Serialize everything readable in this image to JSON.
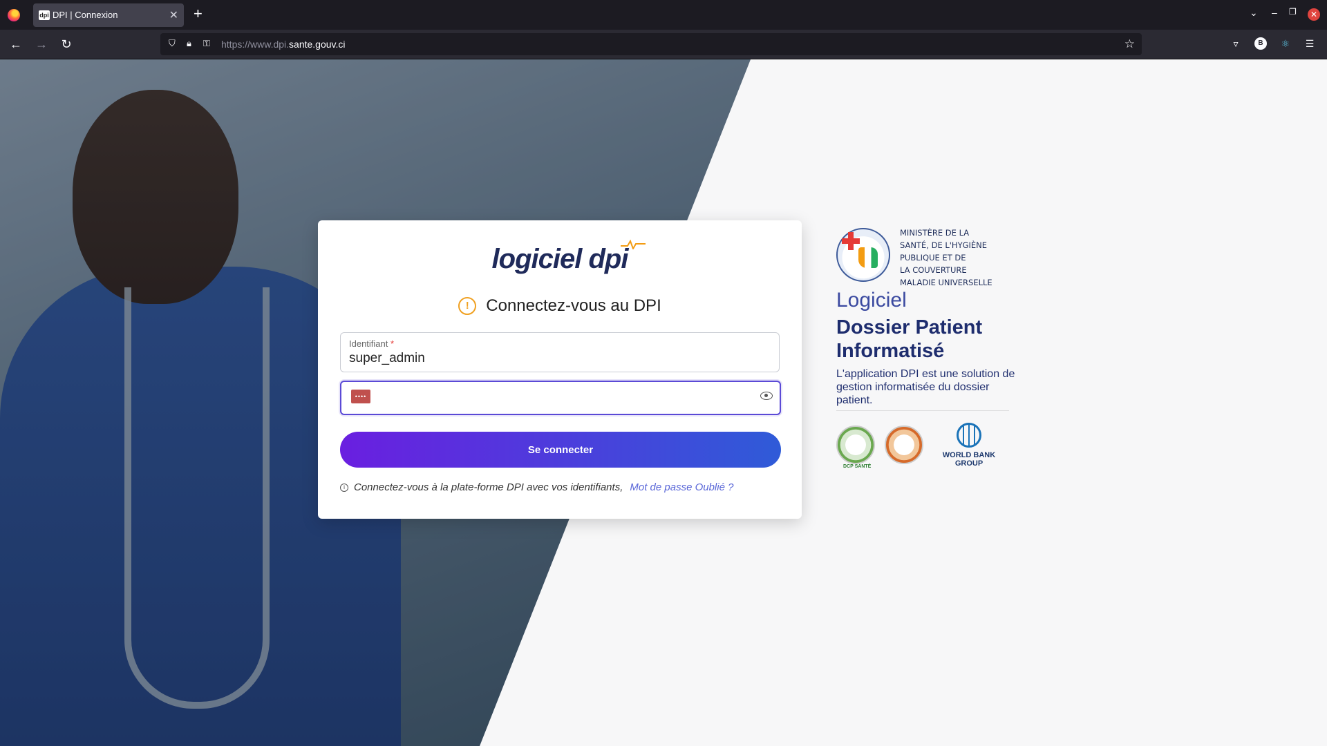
{
  "browser": {
    "tab_title": "DPI | Connexion",
    "tab_favicon": "dpi",
    "url_prefix": "https://www.dpi.",
    "url_domain": "sante.gouv.ci"
  },
  "login": {
    "logo_text": "logiciel dpi",
    "title": "Connectez-vous au DPI",
    "username_label": "Identifiant",
    "username_required": "*",
    "username_value": "super_admin",
    "password_mask": "••••",
    "submit_label": "Se connecter",
    "hint_text": "Connectez-vous à la plate-forme DPI avec vos identifiants,",
    "forgot_link": "Mot de passe Oublié ?"
  },
  "side": {
    "ministry_lines": [
      "MINISTÈRE DE  LA",
      "SANTÉ, DE L'HYGIÈNE",
      "PUBLIQUE ET DE",
      "LA COUVERTURE",
      "MALADIE UNIVERSELLE"
    ],
    "heading_light": "Logiciel",
    "heading_bold": "Dossier Patient Informatisé",
    "description": "L'application DPI est une solution de gestion informatisée du dossier patient.",
    "partner_dsps_label": "DCP SANTÉ",
    "partner_wb_label": "WORLD BANK GROUP"
  },
  "colors": {
    "accent_purple": "#6a1fe0",
    "accent_blue": "#2f5bd8",
    "brand_navy": "#1e2d6e",
    "warning": "#f0a020"
  },
  "icons": [
    "firefox-logo-icon",
    "close-icon",
    "plus-icon",
    "chevron-down-icon",
    "minimize-icon",
    "restore-icon",
    "back-arrow-icon",
    "forward-arrow-icon",
    "reload-icon",
    "shield-icon",
    "lock-icon",
    "key-icon",
    "star-icon",
    "pocket-icon",
    "account-icon",
    "extension-icon",
    "menu-icon",
    "warning-icon",
    "eye-icon",
    "info-icon"
  ]
}
